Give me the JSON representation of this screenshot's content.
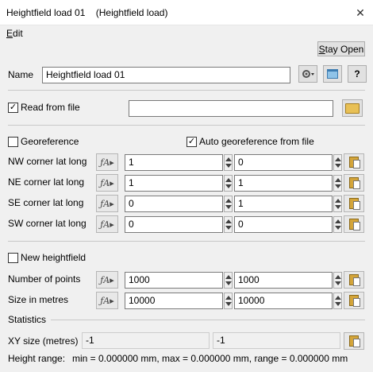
{
  "window": {
    "title": "Heightfield load 01    (Heightfield load)",
    "close_glyph": "✕"
  },
  "menu": {
    "edit_prefix": "E",
    "edit_rest": "dit"
  },
  "stay_open": {
    "prefix": "S",
    "rest": "tay Open"
  },
  "name": {
    "label": "Name",
    "value": "Heightfield load 01",
    "help": "?"
  },
  "read_from_file": {
    "label": "Read from file",
    "checked": true,
    "check_glyph": "✓",
    "value": ""
  },
  "georeference": {
    "label": "Georeference",
    "checked": false
  },
  "auto_georeference": {
    "label": "Auto georeference from file",
    "checked": true,
    "check_glyph": "✓"
  },
  "fx_glyph": "ƒA▸",
  "corners": [
    {
      "label": "NW corner lat long",
      "lat": "1",
      "long": "0"
    },
    {
      "label": "NE corner lat long",
      "lat": "1",
      "long": "1"
    },
    {
      "label": "SE corner lat long",
      "lat": "0",
      "long": "1"
    },
    {
      "label": "SW corner lat long",
      "lat": "0",
      "long": "0"
    }
  ],
  "new_heightfield": {
    "label": "New heightfield",
    "checked": false
  },
  "number_of_points": {
    "label": "Number of points",
    "x": "1000",
    "y": "1000"
  },
  "size_in_metres": {
    "label": "Size in metres",
    "x": "10000",
    "y": "10000"
  },
  "statistics": {
    "title": "Statistics",
    "xy_label": "XY size (metres)",
    "xy_x": "-1",
    "xy_y": "-1",
    "height_range_label": "Height range:",
    "height_range_value": "min = 0.000000 mm, max = 0.000000 mm, range = 0.000000 mm"
  }
}
